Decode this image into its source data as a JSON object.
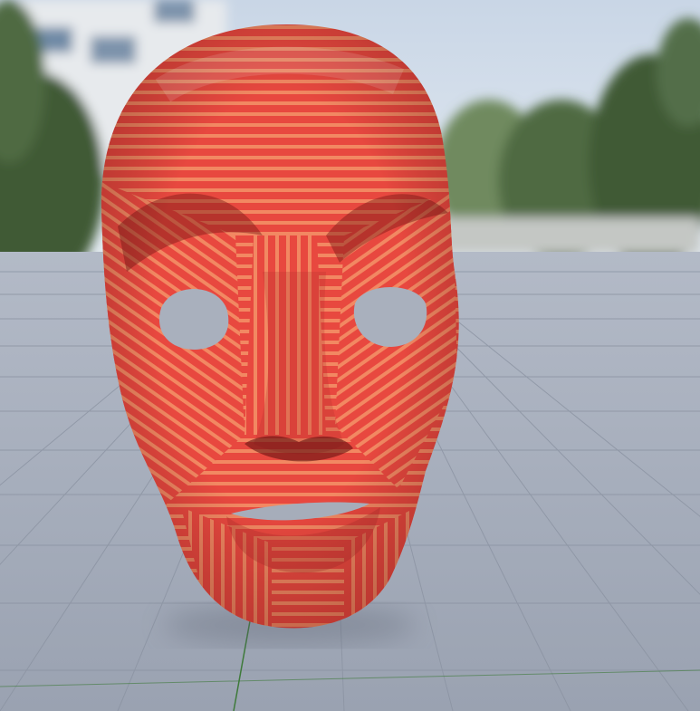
{
  "scene": {
    "subject": "mask-icon",
    "colors": {
      "sky_top": "#c9d6e6",
      "sky_bottom": "#e4ebf2",
      "building": "#e7eaed",
      "foliage_dark": "#3f5a35",
      "foliage_light": "#6f8a5e",
      "floor_near": "#9aa2b1",
      "floor_far": "#b3bac7",
      "grid_line": "#8b93a2",
      "axis_green": "#3e7a3a",
      "mask_base": "#e8483f",
      "mask_stripe": "#f28862",
      "mask_shadow": "#b1302c"
    }
  }
}
